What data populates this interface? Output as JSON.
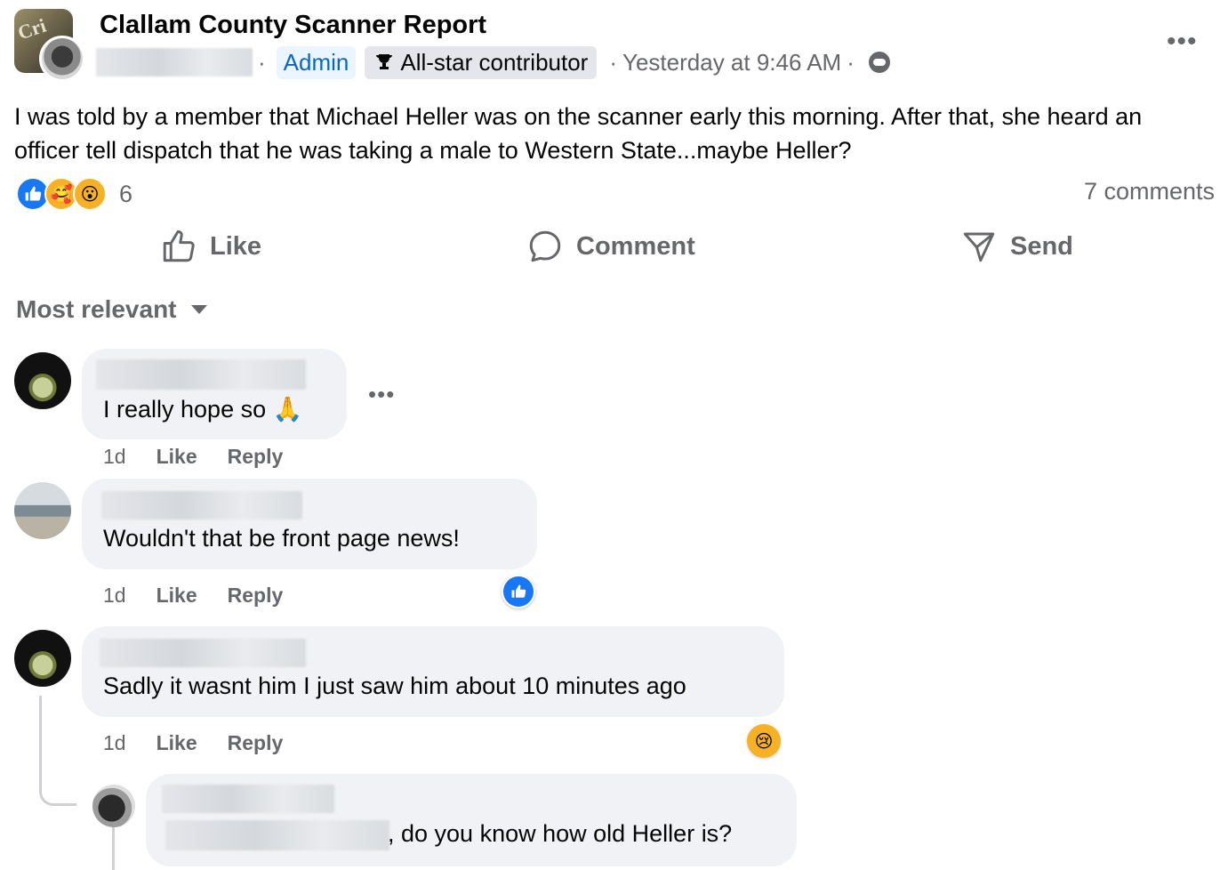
{
  "post": {
    "group_name": "Clallam County Scanner Report",
    "avatar_stamp": "Cri",
    "admin_badge": "Admin",
    "contributor_badge": "All-star contributor",
    "timestamp": "Yesterday at 9:46 AM",
    "body": "I was told by a member that Michael Heller was on the scanner early this morning. After that, she heard an officer tell dispatch that he was taking a male to Western State...maybe Heller?",
    "reaction_count": "6",
    "comments_count": "7 comments",
    "more_label": "•••"
  },
  "actions": {
    "like": "Like",
    "comment": "Comment",
    "send": "Send"
  },
  "sort": {
    "label": "Most relevant"
  },
  "comments": [
    {
      "text": "I really hope so 🙏",
      "time": "1d",
      "like": "Like",
      "reply": "Reply",
      "more": "•••"
    },
    {
      "text": "Wouldn't that be front page news!",
      "time": "1d",
      "like": "Like",
      "reply": "Reply"
    },
    {
      "text": "Sadly it wasnt him I just saw him about 10 minutes ago",
      "time": "1d",
      "like": "Like",
      "reply": "Reply"
    },
    {
      "text": ", do you know how old Heller is?"
    }
  ],
  "icons": {
    "reactions": [
      "like-icon",
      "care-icon",
      "wow-icon"
    ],
    "header": [
      "trophy-icon",
      "privacy-icon",
      "more-icon"
    ],
    "actions": [
      "thumbs-up-icon",
      "comment-icon",
      "send-icon"
    ]
  },
  "colors": {
    "accent": "#1877f2",
    "muted": "#65676b",
    "bubble": "#f0f2f5",
    "admin_bg": "#ebf5ff"
  }
}
